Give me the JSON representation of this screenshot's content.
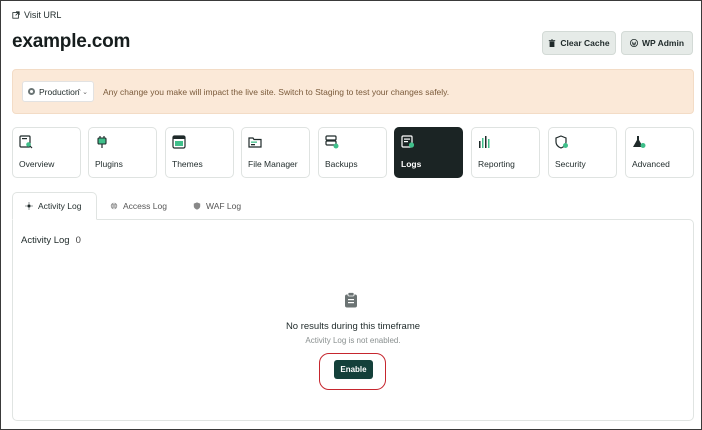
{
  "header": {
    "visit_url_label": "Visit URL",
    "site_title": "example.com",
    "clear_cache_label": "Clear Cache",
    "wp_admin_label": "WP Admin"
  },
  "banner": {
    "environment": "Production",
    "message": "Any change you make will impact the live site. Switch to Staging to test your changes safely."
  },
  "nav": {
    "items": [
      {
        "label": "Overview",
        "icon": "overview-icon"
      },
      {
        "label": "Plugins",
        "icon": "plugin-icon"
      },
      {
        "label": "Themes",
        "icon": "themes-icon"
      },
      {
        "label": "File Manager",
        "icon": "folder-icon"
      },
      {
        "label": "Backups",
        "icon": "backups-icon"
      },
      {
        "label": "Logs",
        "icon": "logs-icon",
        "active": true
      },
      {
        "label": "Reporting",
        "icon": "chart-icon"
      },
      {
        "label": "Security",
        "icon": "shield-icon"
      },
      {
        "label": "Advanced",
        "icon": "flask-icon"
      }
    ]
  },
  "tabs": [
    {
      "label": "Activity Log",
      "active": true
    },
    {
      "label": "Access Log"
    },
    {
      "label": "WAF Log"
    }
  ],
  "panel": {
    "title": "Activity Log",
    "count": "0",
    "empty_title": "No results during this timeframe",
    "empty_subtitle": "Activity Log is not enabled.",
    "enable_label": "Enable"
  },
  "colors": {
    "accent_green": "#14403a",
    "icon_green": "#3fbf8a",
    "banner_bg": "#fbe9d8",
    "active_card": "#1b2424",
    "highlight_red": "#c6262e"
  }
}
